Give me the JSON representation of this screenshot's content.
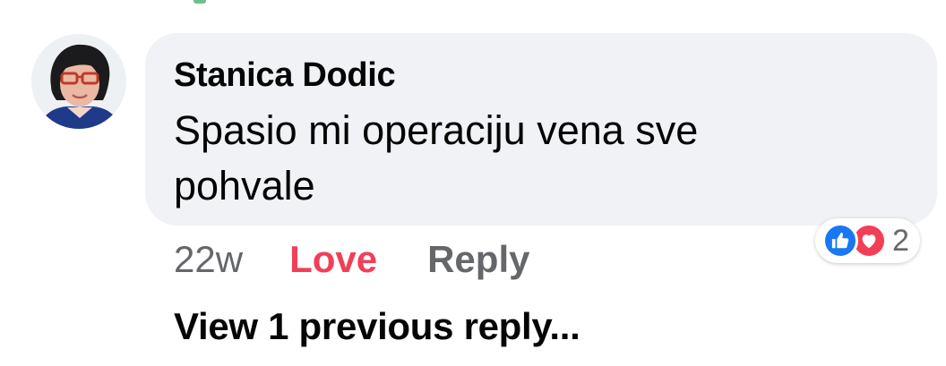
{
  "comment": {
    "author": "Stanica Dodic",
    "text": "Spasio mi operaciju vena sve pohvale",
    "avatar_icon": "user-photo-avatar"
  },
  "reactions": {
    "count": "2",
    "types": [
      "like-icon",
      "love-icon"
    ],
    "like_color": "#1877f2",
    "love_color": "#f33e58"
  },
  "actions": {
    "timestamp": "22w",
    "love_label": "Love",
    "reply_label": "Reply"
  },
  "replies": {
    "view_previous_label": "View 1 previous reply..."
  },
  "colors": {
    "bubble_bg": "#f0f2f5",
    "secondary_text": "#65676b",
    "love_active": "#f33e58"
  }
}
